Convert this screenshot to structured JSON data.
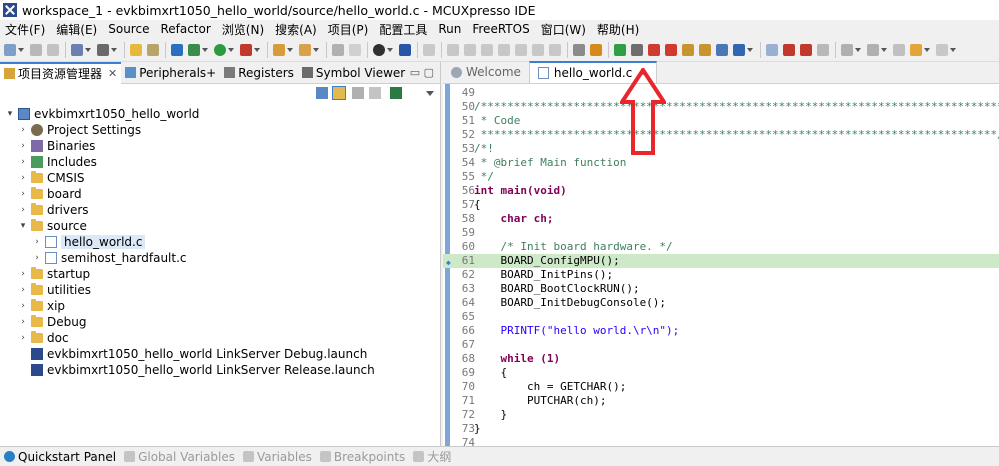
{
  "window": {
    "title": "workspace_1 - evkbimxrt1050_hello_world/source/hello_world.c - MCUXpresso IDE"
  },
  "menu": [
    "文件(F)",
    "编辑(E)",
    "Source",
    "Refactor",
    "浏览(N)",
    "搜索(A)",
    "项目(P)",
    "配置工具",
    "Run",
    "FreeRTOS",
    "窗口(W)",
    "帮助(H)"
  ],
  "left_tabs": [
    {
      "label": "项目资源管理器",
      "closable": true
    },
    {
      "label": "Peripherals+",
      "closable": false
    },
    {
      "label": "Registers",
      "closable": false
    },
    {
      "label": "Symbol Viewer",
      "closable": false
    }
  ],
  "tree": {
    "project": "evkbimxrt1050_hello_world",
    "items": [
      {
        "label": "Project Settings",
        "icon": "gear-icon"
      },
      {
        "label": "Binaries",
        "icon": "binaries-icon"
      },
      {
        "label": "Includes",
        "icon": "includes-icon"
      },
      {
        "label": "CMSIS",
        "icon": "folder-icon"
      },
      {
        "label": "board",
        "icon": "folder-icon"
      },
      {
        "label": "drivers",
        "icon": "folder-icon"
      },
      {
        "label": "source",
        "icon": "folder-icon"
      },
      {
        "label": "hello_world.c",
        "icon": "c-file-icon"
      },
      {
        "label": "semihost_hardfault.c",
        "icon": "c-file-icon"
      },
      {
        "label": "startup",
        "icon": "folder-icon"
      },
      {
        "label": "utilities",
        "icon": "folder-icon"
      },
      {
        "label": "xip",
        "icon": "folder-icon"
      },
      {
        "label": "Debug",
        "icon": "folder-icon"
      },
      {
        "label": "doc",
        "icon": "folder-icon"
      },
      {
        "label": "evkbimxrt1050_hello_world LinkServer Debug.launch",
        "icon": "launch-icon"
      },
      {
        "label": "evkbimxrt1050_hello_world LinkServer Release.launch",
        "icon": "launch-icon"
      }
    ]
  },
  "editor": {
    "tabs": [
      {
        "label": "Welcome"
      },
      {
        "label": "hello_world.c",
        "close": "×"
      }
    ],
    "lines": [
      {
        "n": "49",
        "text": ""
      },
      {
        "n": "50",
        "text": "/*******************************************************************************"
      },
      {
        "n": "51",
        "text": " * Code"
      },
      {
        "n": "52",
        "text": " ******************************************************************************/"
      },
      {
        "n": "53",
        "text": "/*!"
      },
      {
        "n": "54",
        "text": " * @brief Main function"
      },
      {
        "n": "55",
        "text": " */"
      },
      {
        "n": "56",
        "text": "int main(void)"
      },
      {
        "n": "57",
        "text": "{"
      },
      {
        "n": "58",
        "text": "    char ch;"
      },
      {
        "n": "59",
        "text": ""
      },
      {
        "n": "60",
        "text": "    /* Init board hardware. */"
      },
      {
        "n": "61",
        "text": "    BOARD_ConfigMPU();"
      },
      {
        "n": "62",
        "text": "    BOARD_InitPins();"
      },
      {
        "n": "63",
        "text": "    BOARD_BootClockRUN();"
      },
      {
        "n": "64",
        "text": "    BOARD_InitDebugConsole();"
      },
      {
        "n": "65",
        "text": ""
      },
      {
        "n": "66",
        "text": "    PRINTF(\"hello world.\\r\\n\");"
      },
      {
        "n": "67",
        "text": ""
      },
      {
        "n": "68",
        "text": "    while (1)"
      },
      {
        "n": "69",
        "text": "    {"
      },
      {
        "n": "70",
        "text": "        ch = GETCHAR();"
      },
      {
        "n": "71",
        "text": "        PUTCHAR(ch);"
      },
      {
        "n": "72",
        "text": "    }"
      },
      {
        "n": "73",
        "text": "}"
      },
      {
        "n": "74",
        "text": ""
      }
    ]
  },
  "bottom_tabs": [
    "Quickstart Panel",
    "Global Variables",
    "Variables",
    "Breakpoints",
    "大纲"
  ],
  "colors": {
    "annotation_arrow": "#e8262c",
    "accent": "#3c7fd1"
  }
}
